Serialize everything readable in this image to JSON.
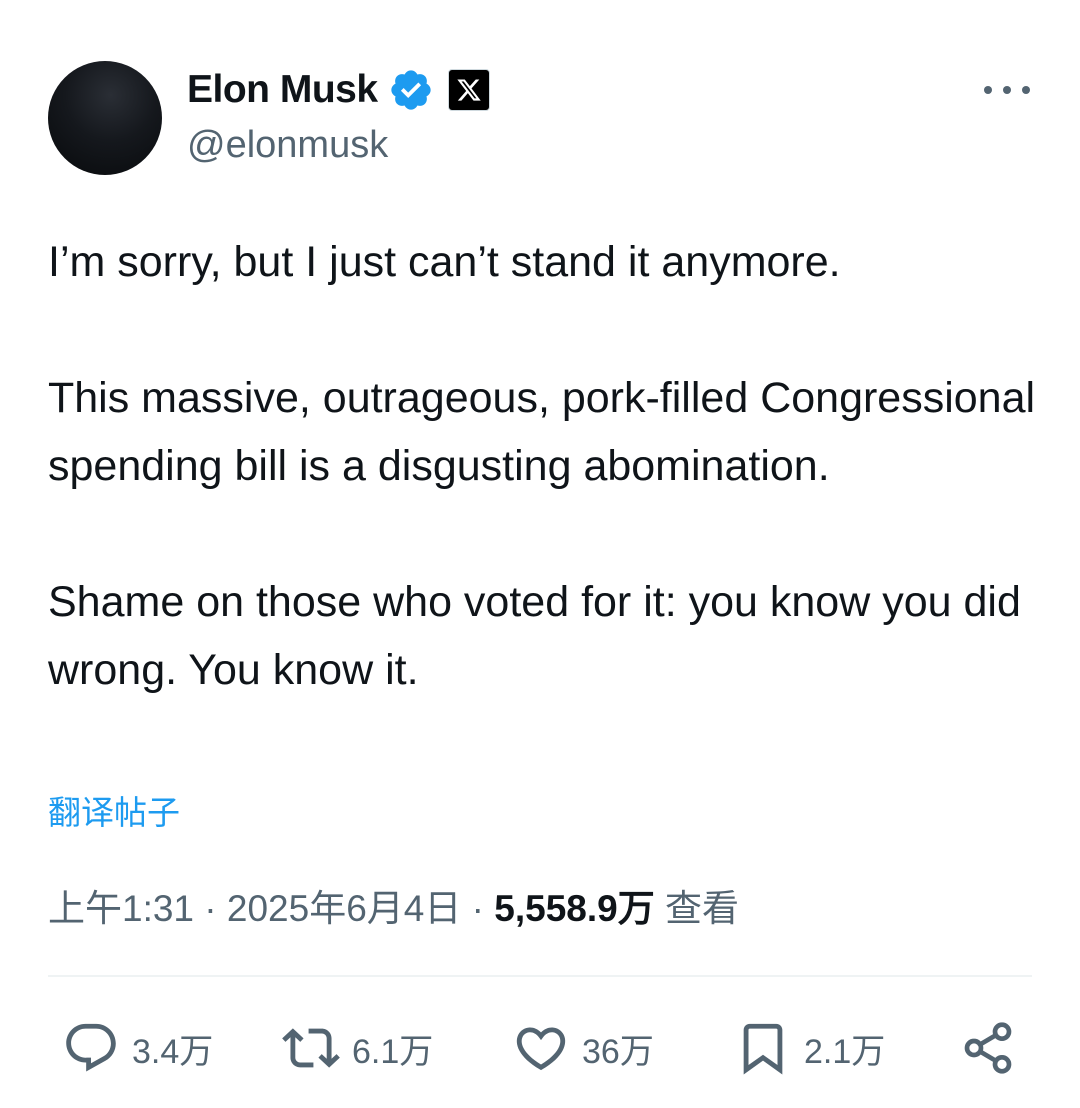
{
  "author": {
    "display_name": "Elon Musk",
    "handle": "@elonmusk",
    "verified_icon": "verified-badge-icon",
    "affiliation_icon": "x-logo-icon"
  },
  "tweet": {
    "paragraphs": [
      "I’m sorry, but I just can’t stand it anymore.",
      "This massive, outrageous, pork-filled Congressional spending bill is a disgusting abomination.",
      "Shame on those who voted for it: you know you did wrong. You know it."
    ],
    "translate_label": "翻译帖子",
    "time": "上午1:31",
    "date": "2025年6月4日",
    "views_count": "5,558.9万",
    "views_label": "查看"
  },
  "actions": {
    "replies": "3.4万",
    "reposts": "6.1万",
    "likes": "36万",
    "bookmarks": "2.1万"
  },
  "colors": {
    "accent": "#1d9bf0",
    "text_primary": "#0f1419",
    "text_secondary": "#536471"
  }
}
